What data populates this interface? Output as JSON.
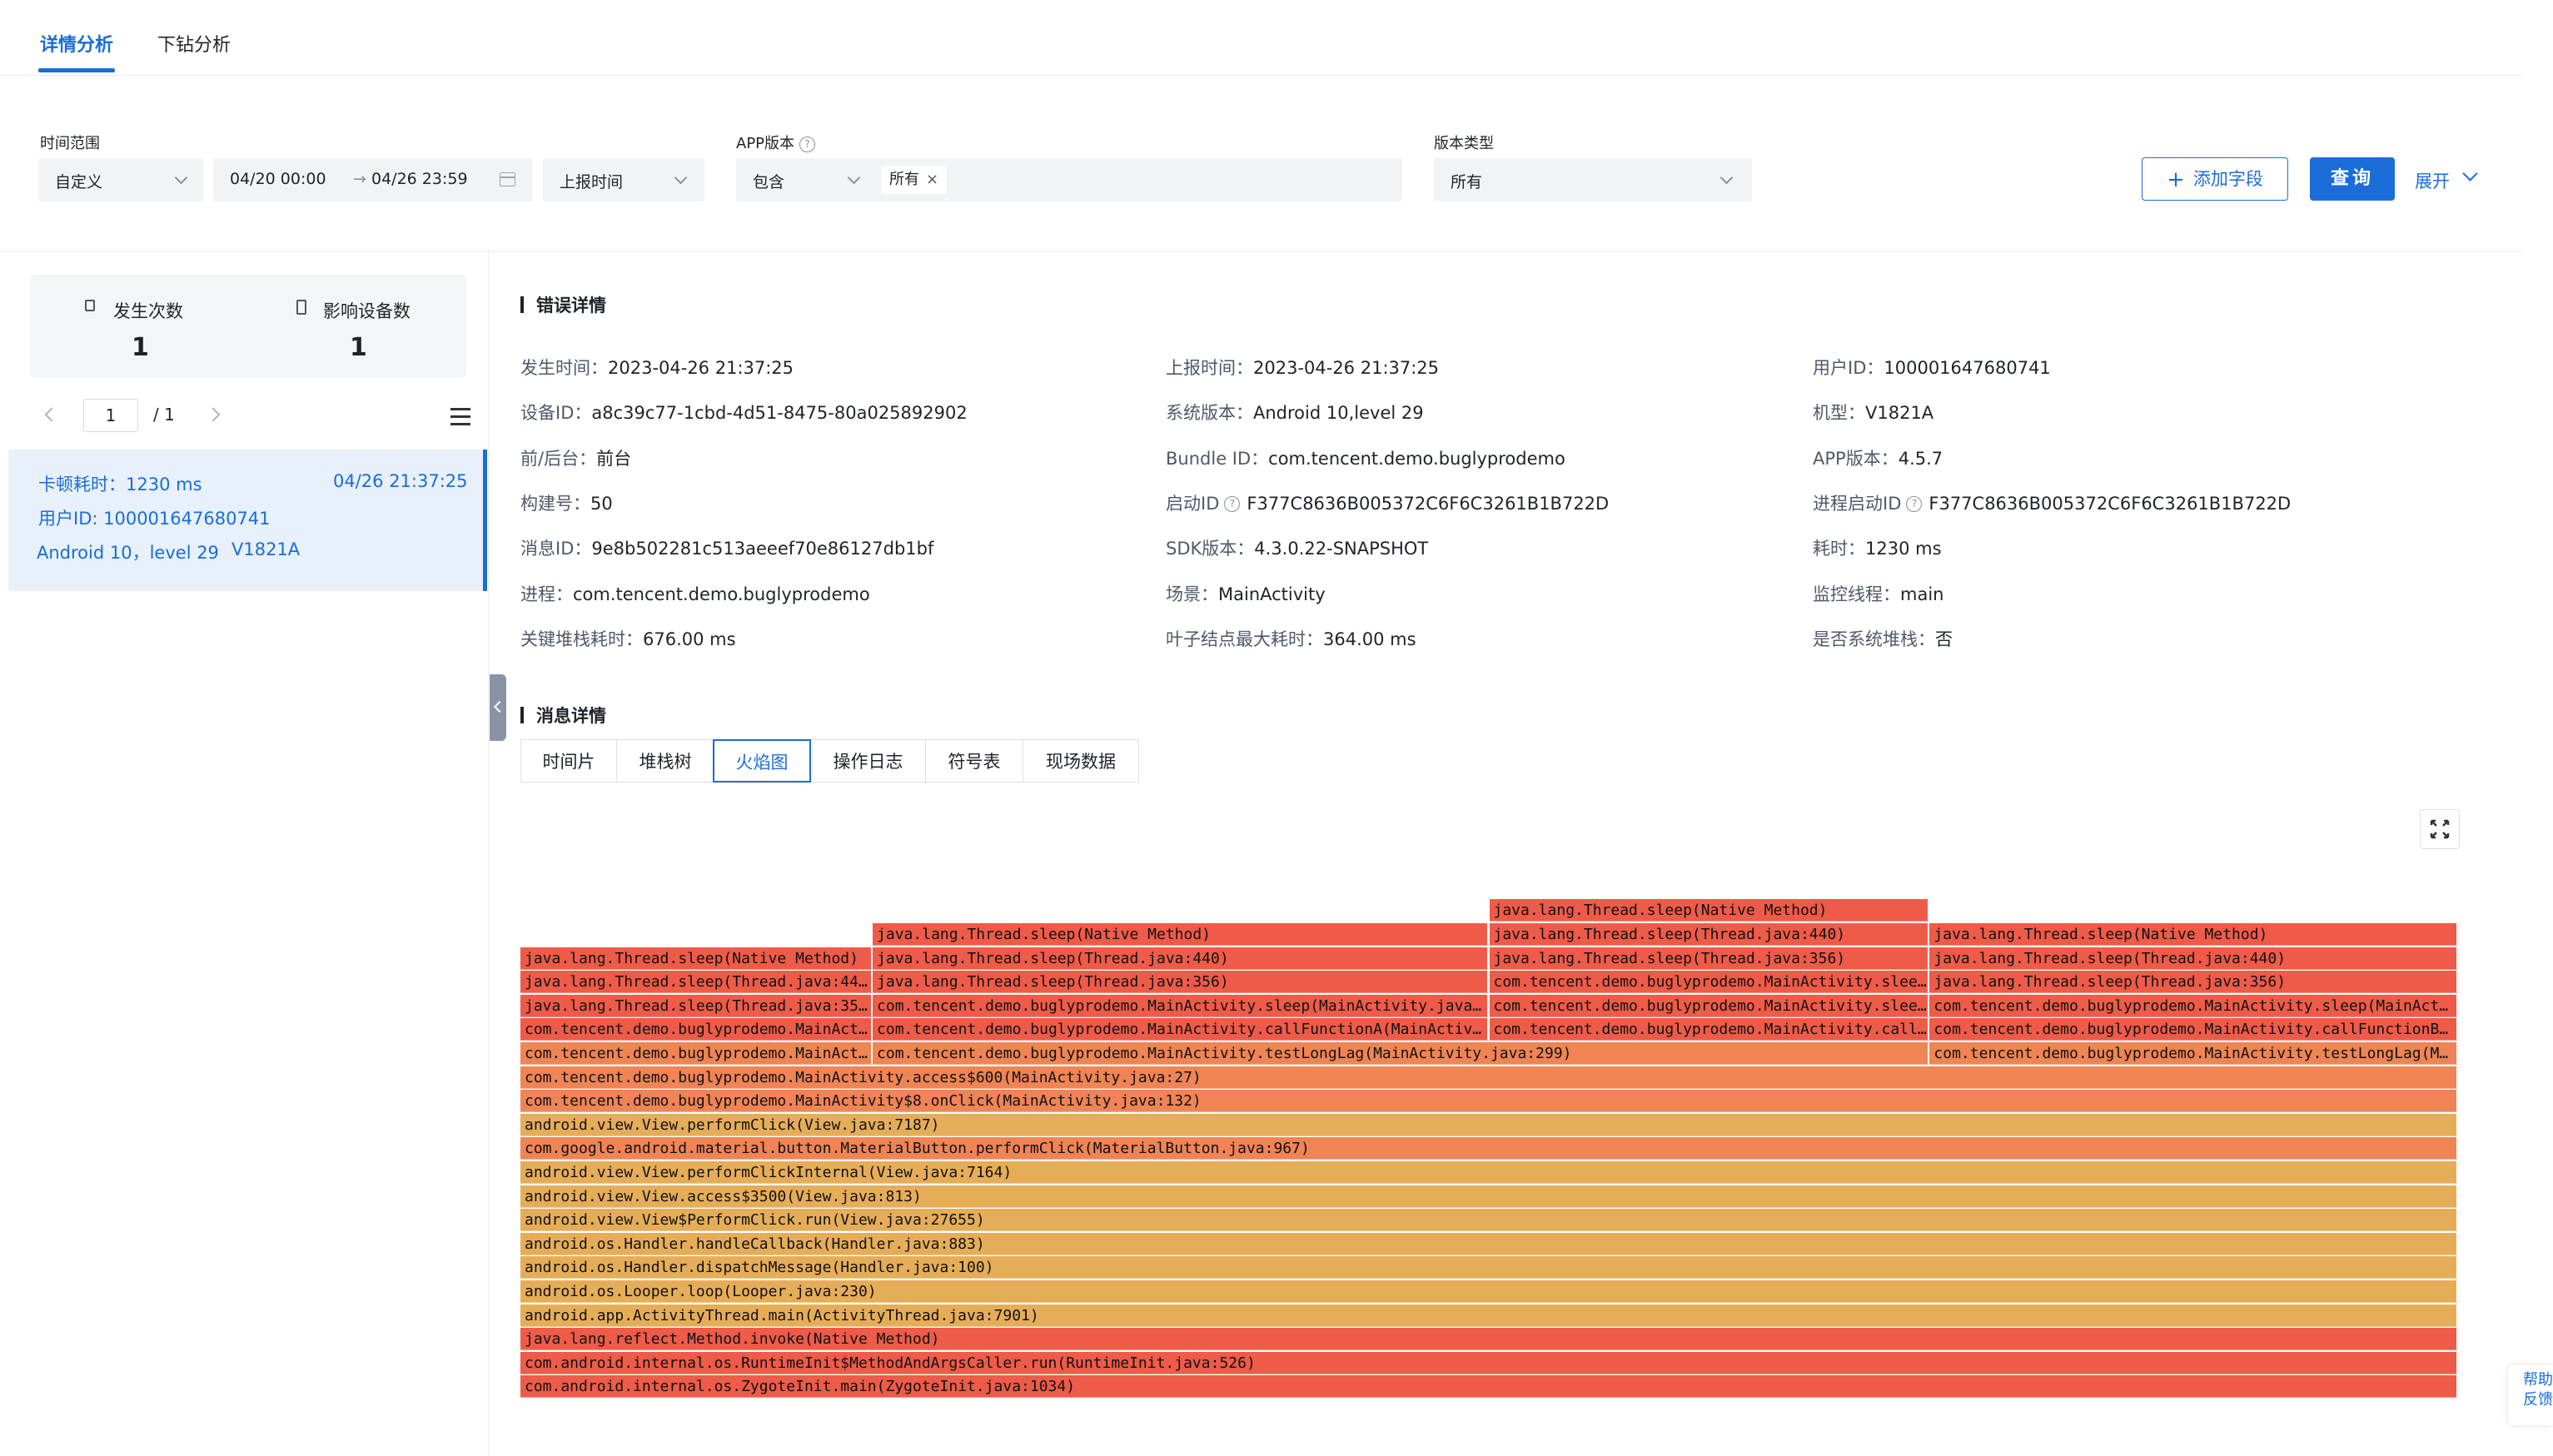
{
  "tabs": {
    "detail": "详情分析",
    "drilldown": "下钻分析"
  },
  "filters": {
    "time_range_label": "时间范围",
    "time_range_value": "自定义",
    "date_start": "04/20 00:00",
    "date_arrow": "→",
    "date_end": "04/26 23:59",
    "time_field_value": "上报时间",
    "app_version_label": "APP版本",
    "app_version_op": "包含",
    "app_version_tag": "所有",
    "version_type_label": "版本类型",
    "version_type_value": "所有",
    "add_field": "添加字段",
    "query": "查询",
    "expand": "展开"
  },
  "stats": {
    "occur_label": "发生次数",
    "occur_value": "1",
    "devices_label": "影响设备数",
    "devices_value": "1"
  },
  "pager": {
    "current": "1",
    "total": "/ 1"
  },
  "list": [
    {
      "lag": "卡顿耗时：1230 ms",
      "time": "04/26 21:37:25",
      "user": "用户ID:  100001647680741",
      "os": "Android 10，level 29",
      "model": "V1821A"
    }
  ],
  "error_detail": {
    "title": "错误详情",
    "fields": [
      {
        "k": "发生时间：",
        "v": "2023-04-26 21:37:25"
      },
      {
        "k": "上报时间：",
        "v": "2023-04-26 21:37:25"
      },
      {
        "k": "用户ID：",
        "v": "100001647680741"
      },
      {
        "k": "设备ID：",
        "v": "a8c39c77-1cbd-4d51-8475-80a025892902"
      },
      {
        "k": "系统版本：",
        "v": "Android 10,level 29"
      },
      {
        "k": "机型：",
        "v": "V1821A"
      },
      {
        "k": "前/后台：",
        "v": "前台"
      },
      {
        "k": "Bundle ID：",
        "v": "com.tencent.demo.buglyprodemo"
      },
      {
        "k": "APP版本：",
        "v": "4.5.7"
      },
      {
        "k": "构建号：",
        "v": "50"
      },
      {
        "k": "启动ID",
        "v": "F377C8636B005372C6F6C3261B1B722D"
      },
      {
        "k": "进程启动ID",
        "v": "F377C8636B005372C6F6C3261B1B722D"
      },
      {
        "k": "消息ID：",
        "v": "9e8b502281c513aeeef70e86127db1bf"
      },
      {
        "k": "SDK版本：",
        "v": "4.3.0.22-SNAPSHOT"
      },
      {
        "k": "耗时：",
        "v": "1230 ms"
      },
      {
        "k": "进程：",
        "v": "com.tencent.demo.buglyprodemo"
      },
      {
        "k": "场景：",
        "v": "MainActivity"
      },
      {
        "k": "监控线程：",
        "v": "main"
      },
      {
        "k": "关键堆栈耗时：",
        "v": "676.00 ms"
      },
      {
        "k": "叶子结点最大耗时：",
        "v": "364.00 ms"
      },
      {
        "k": "是否系统堆栈：",
        "v": "否"
      }
    ]
  },
  "message_detail": {
    "title": "消息详情",
    "subtabs": [
      "时间片",
      "堆栈树",
      "火焰图",
      "操作日志",
      "符号表",
      "现场数据"
    ]
  },
  "flame": {
    "colors": {
      "red": "#ee5b49",
      "orange": "#f08454",
      "amber": "#e6ad58"
    },
    "frames": [
      {
        "t": "com.android.internal.os.ZygoteInit.main(ZygoteInit.java:1034)",
        "d": 0,
        "s": 0,
        "e": 1,
        "c": "red"
      },
      {
        "t": "com.android.internal.os.RuntimeInit$MethodAndArgsCaller.run(RuntimeInit.java:526)",
        "d": 1,
        "s": 0,
        "e": 1,
        "c": "red"
      },
      {
        "t": "java.lang.reflect.Method.invoke(Native Method)",
        "d": 2,
        "s": 0,
        "e": 1,
        "c": "red"
      },
      {
        "t": "android.app.ActivityThread.main(ActivityThread.java:7901)",
        "d": 3,
        "s": 0,
        "e": 1,
        "c": "amber"
      },
      {
        "t": "android.os.Looper.loop(Looper.java:230)",
        "d": 4,
        "s": 0,
        "e": 1,
        "c": "amber"
      },
      {
        "t": "android.os.Handler.dispatchMessage(Handler.java:100)",
        "d": 5,
        "s": 0,
        "e": 1,
        "c": "amber"
      },
      {
        "t": "android.os.Handler.handleCallback(Handler.java:883)",
        "d": 6,
        "s": 0,
        "e": 1,
        "c": "amber"
      },
      {
        "t": "android.view.View$PerformClick.run(View.java:27655)",
        "d": 7,
        "s": 0,
        "e": 1,
        "c": "amber"
      },
      {
        "t": "android.view.View.access$3500(View.java:813)",
        "d": 8,
        "s": 0,
        "e": 1,
        "c": "amber"
      },
      {
        "t": "android.view.View.performClickInternal(View.java:7164)",
        "d": 9,
        "s": 0,
        "e": 1,
        "c": "amber"
      },
      {
        "t": "com.google.android.material.button.MaterialButton.performClick(MaterialButton.java:967)",
        "d": 10,
        "s": 0,
        "e": 1,
        "c": "orange"
      },
      {
        "t": "android.view.View.performClick(View.java:7187)",
        "d": 11,
        "s": 0,
        "e": 1,
        "c": "amber"
      },
      {
        "t": "com.tencent.demo.buglyprodemo.MainActivity$8.onClick(MainActivity.java:132)",
        "d": 12,
        "s": 0,
        "e": 1,
        "c": "orange"
      },
      {
        "t": "com.tencent.demo.buglyprodemo.MainActivity.access$600(MainActivity.java:27)",
        "d": 13,
        "s": 0,
        "e": 1,
        "c": "orange"
      },
      {
        "t": "com.tencent.demo.buglyprodemo.MainActivity.testLongLag(MainActivity.java:...)",
        "d": 14,
        "s": 0,
        "e": 0.1818,
        "c": "orange"
      },
      {
        "t": "com.tencent.demo.buglyprodemo.MainActivity.testLongLag(MainActivity.java:299)",
        "d": 14,
        "s": 0.1818,
        "e": 0.7273,
        "c": "orange"
      },
      {
        "t": "com.tencent.demo.buglyprodemo.MainActivity.testLongLag(MainActivity.java:...)",
        "d": 14,
        "s": 0.7273,
        "e": 1,
        "c": "orange"
      },
      {
        "t": "com.tencent.demo.buglyprodemo.MainActivity.sleep(MainActivity.java:...)",
        "d": 15,
        "s": 0,
        "e": 0.1818,
        "c": "red"
      },
      {
        "t": "com.tencent.demo.buglyprodemo.MainActivity.callFunctionA(MainActivity.java:...)",
        "d": 15,
        "s": 0.1818,
        "e": 0.5,
        "c": "red"
      },
      {
        "t": "com.tencent.demo.buglyprodemo.MainActivity.callFunctionA(MainActivity.java:...)",
        "d": 15,
        "s": 0.5,
        "e": 0.7273,
        "c": "red"
      },
      {
        "t": "com.tencent.demo.buglyprodemo.MainActivity.callFunctionB(MainActivity.java:...)",
        "d": 15,
        "s": 0.7273,
        "e": 1,
        "c": "red"
      },
      {
        "t": "java.lang.Thread.sleep(Thread.java:356)",
        "d": 16,
        "s": 0,
        "e": 0.1818,
        "c": "red"
      },
      {
        "t": "com.tencent.demo.buglyprodemo.MainActivity.sleep(MainActivity.java:34...)",
        "d": 16,
        "s": 0.1818,
        "e": 0.5,
        "c": "red"
      },
      {
        "t": "com.tencent.demo.buglyprodemo.MainActivity.sleep(MainActivity.java:...)",
        "d": 16,
        "s": 0.5,
        "e": 0.7273,
        "c": "red"
      },
      {
        "t": "com.tencent.demo.buglyprodemo.MainActivity.sleep(MainActivity.java:...)",
        "d": 16,
        "s": 0.7273,
        "e": 1,
        "c": "red"
      },
      {
        "t": "java.lang.Thread.sleep(Thread.java:440)",
        "d": 17,
        "s": 0,
        "e": 0.1818,
        "c": "red"
      },
      {
        "t": "java.lang.Thread.sleep(Thread.java:356)",
        "d": 17,
        "s": 0.1818,
        "e": 0.5,
        "c": "red"
      },
      {
        "t": "com.tencent.demo.buglyprodemo.MainActivity.sleep(MainActivity.java:...)",
        "d": 17,
        "s": 0.5,
        "e": 0.7273,
        "c": "red"
      },
      {
        "t": "java.lang.Thread.sleep(Thread.java:356)",
        "d": 17,
        "s": 0.7273,
        "e": 1,
        "c": "red"
      },
      {
        "t": "java.lang.Thread.sleep(Native Method)",
        "d": 18,
        "s": 0,
        "e": 0.1818,
        "c": "red"
      },
      {
        "t": "java.lang.Thread.sleep(Thread.java:440)",
        "d": 18,
        "s": 0.1818,
        "e": 0.5,
        "c": "red"
      },
      {
        "t": "java.lang.Thread.sleep(Thread.java:356)",
        "d": 18,
        "s": 0.5,
        "e": 0.7273,
        "c": "red"
      },
      {
        "t": "java.lang.Thread.sleep(Thread.java:440)",
        "d": 18,
        "s": 0.7273,
        "e": 1,
        "c": "red"
      },
      {
        "t": "java.lang.Thread.sleep(Native Method)",
        "d": 19,
        "s": 0.1818,
        "e": 0.5,
        "c": "red"
      },
      {
        "t": "java.lang.Thread.sleep(Thread.java:440)",
        "d": 19,
        "s": 0.5,
        "e": 0.7273,
        "c": "red"
      },
      {
        "t": "java.lang.Thread.sleep(Native Method)",
        "d": 19,
        "s": 0.7273,
        "e": 1,
        "c": "red"
      },
      {
        "t": "java.lang.Thread.sleep(Native Method)",
        "d": 20,
        "s": 0.5,
        "e": 0.7273,
        "c": "red"
      }
    ]
  },
  "help": {
    "line1": "帮助",
    "line2": "反馈"
  }
}
